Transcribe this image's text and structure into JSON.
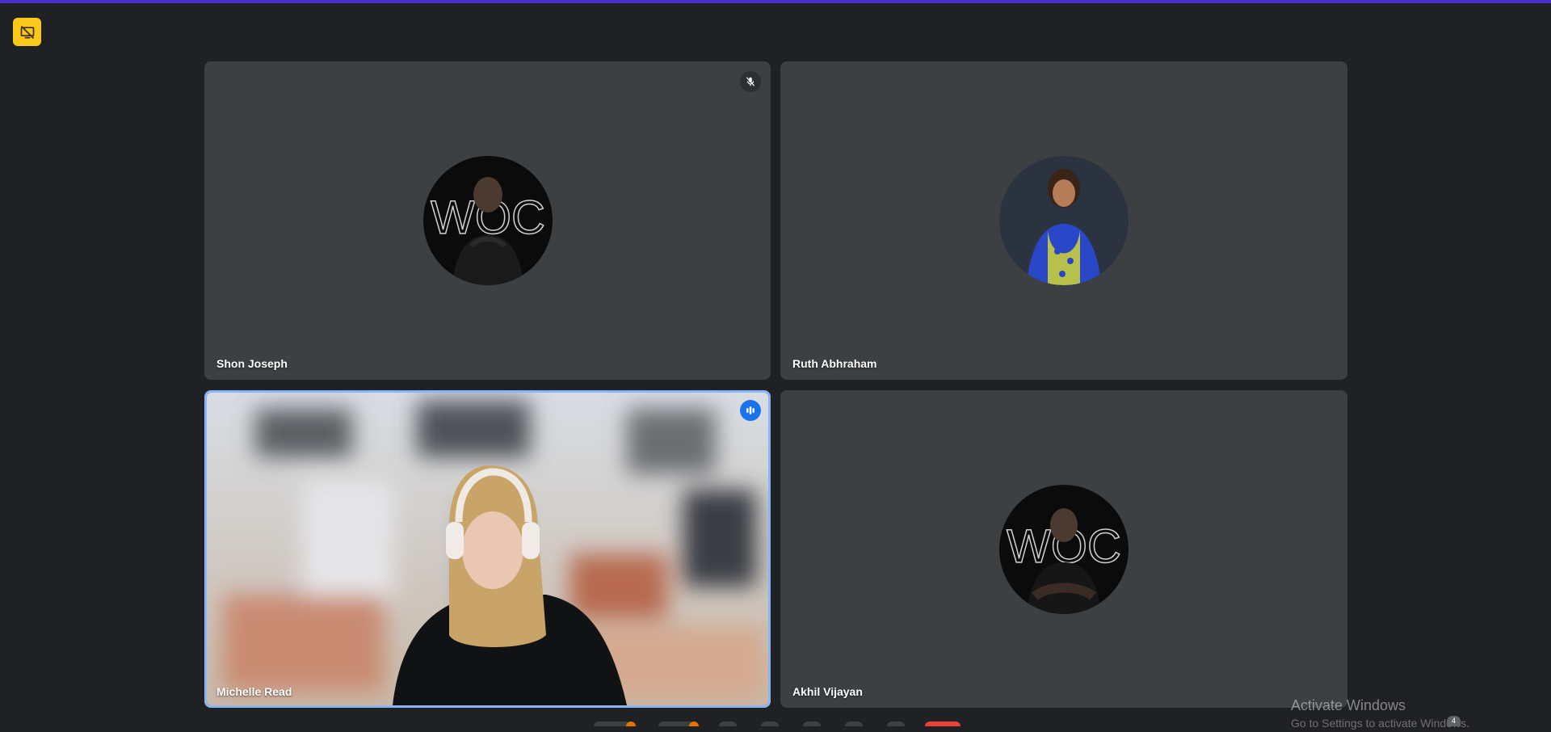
{
  "colors": {
    "background": "#202124",
    "tile": "#3c4043",
    "accent_bar": "#4a2fc8",
    "present_button": "#f9c81a",
    "active_speaker_border": "#8ab4f8",
    "speaking_badge": "#1a73e8"
  },
  "toolbar": {
    "present_icon": "screen-share-off-icon"
  },
  "participants": [
    {
      "name": "Shon Joseph",
      "mic": "muted",
      "video": "off",
      "avatar_icon": "avatar-image"
    },
    {
      "name": "Ruth Abhraham",
      "mic": "on",
      "video": "off",
      "avatar_icon": "avatar-image"
    },
    {
      "name": "Michelle Read",
      "mic": "speaking",
      "video": "on",
      "active_speaker": true
    },
    {
      "name": "Akhil Vijayan",
      "mic": "on",
      "video": "off",
      "avatar_icon": "avatar-image"
    }
  ],
  "system_overlay": {
    "activation_title": "Activate Windows",
    "activation_subtitle": "Go to Settings to activate Windows.",
    "notification_count": "4"
  }
}
